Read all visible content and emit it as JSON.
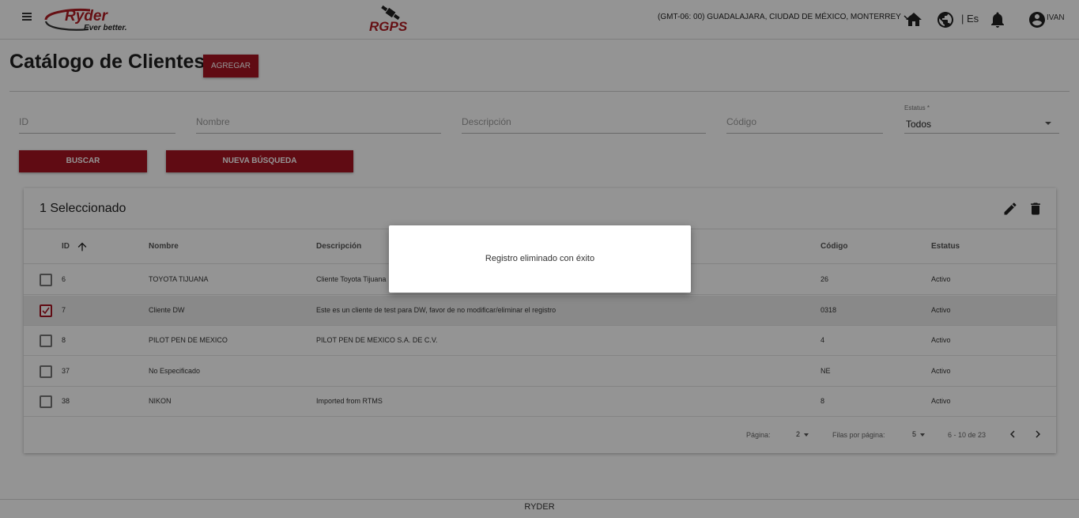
{
  "header": {
    "brand_name": "Ryder",
    "brand_tagline": "Ever better.",
    "app_logo": "RGPS",
    "timezone": "(GMT-06: 00) GUADALAJARA, CIUDAD DE MÉXICO, MONTERREY",
    "language": "| Es",
    "user": "IVAN",
    "icons": [
      "menu-icon",
      "home-icon",
      "globe-icon",
      "bell-icon",
      "account-circle-icon"
    ]
  },
  "page": {
    "title": "Catálogo de Clientes",
    "add_button": "AGREGAR"
  },
  "filters": {
    "id_placeholder": "ID",
    "nombre_placeholder": "Nombre",
    "descripcion_placeholder": "Descripción",
    "codigo_placeholder": "Código",
    "status_label": "Estatus *",
    "status_value": "Todos",
    "search_button": "BUSCAR",
    "new_search_button": "NUEVA BÚSQUEDA"
  },
  "table": {
    "selected_text": "1 Seleccionado",
    "columns": {
      "id": "ID",
      "nombre": "Nombre",
      "descripcion": "Descripción",
      "codigo": "Código",
      "estatus": "Estatus"
    },
    "rows": [
      {
        "checked": false,
        "id": "6",
        "nombre": "TOYOTA TIJUANA",
        "descripcion": "Cliente Toyota Tijuana",
        "codigo": "26",
        "estatus": "Activo"
      },
      {
        "checked": true,
        "id": "7",
        "nombre": "Cliente DW",
        "descripcion": "Este es un cliente de test para DW, favor de no modificar/eliminar el registro",
        "codigo": "0318",
        "estatus": "Activo"
      },
      {
        "checked": false,
        "id": "8",
        "nombre": "PILOT PEN DE MEXICO",
        "descripcion": "PILOT PEN DE MEXICO S.A. DE C.V.",
        "codigo": "4",
        "estatus": "Activo"
      },
      {
        "checked": false,
        "id": "37",
        "nombre": "No Especificado",
        "descripcion": "",
        "codigo": "NE",
        "estatus": "Activo"
      },
      {
        "checked": false,
        "id": "38",
        "nombre": "NIKON",
        "descripcion": "Imported from RTMS",
        "codigo": "8",
        "estatus": "Activo"
      }
    ],
    "pagination": {
      "page_label": "Página:",
      "page_value": "2",
      "rows_label": "Filas por página:",
      "rows_value": "5",
      "range": "6 - 10 de 23"
    }
  },
  "footer": {
    "text": "RYDER"
  },
  "dialog": {
    "message": "Registro eliminado con éxito"
  },
  "colors": {
    "accent": "#a61422",
    "overlay": "rgba(0,0,0,0.42)"
  }
}
